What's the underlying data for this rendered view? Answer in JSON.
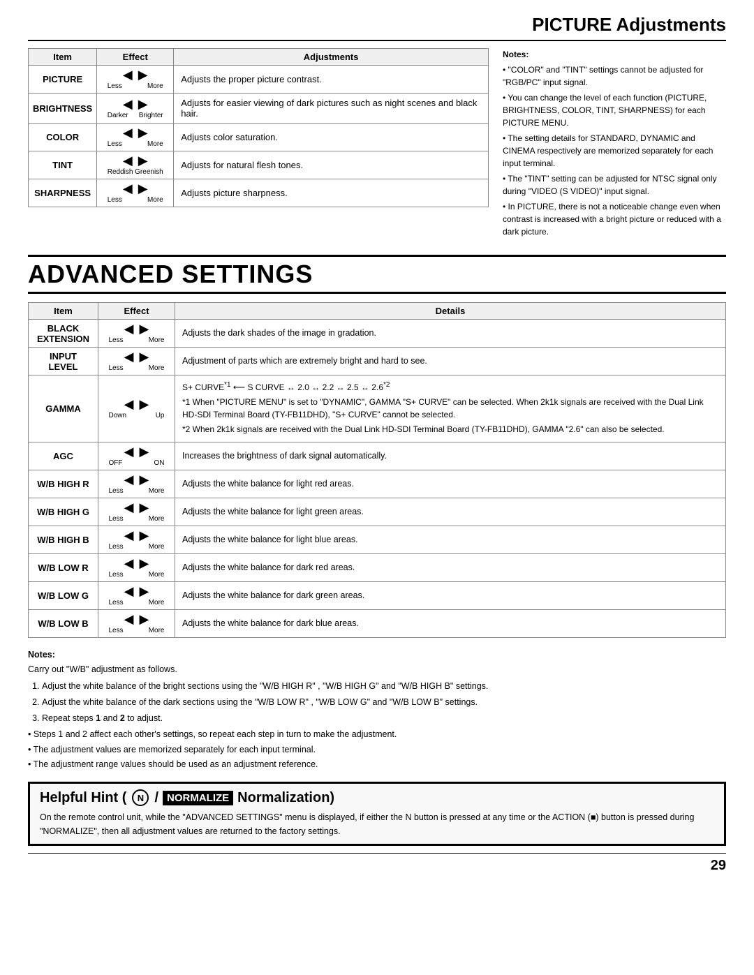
{
  "page": {
    "title": "PICTURE Adjustments",
    "advanced_title": "ADVANCED SETTINGS",
    "page_number": "29"
  },
  "picture_table": {
    "headers": [
      "Item",
      "Effect",
      "Adjustments"
    ],
    "rows": [
      {
        "item": "PICTURE",
        "arrow_left_label": "Less",
        "arrow_right_label": "More",
        "description": "Adjusts the proper picture contrast."
      },
      {
        "item": "BRIGHTNESS",
        "arrow_left_label": "Darker",
        "arrow_right_label": "Brighter",
        "description": "Adjusts for easier viewing of dark pictures such as night scenes and black hair."
      },
      {
        "item": "COLOR",
        "arrow_left_label": "Less",
        "arrow_right_label": "More",
        "description": "Adjusts color saturation."
      },
      {
        "item": "TINT",
        "arrow_left_label": "Reddish",
        "arrow_right_label": "Greenish",
        "description": "Adjusts for natural flesh tones."
      },
      {
        "item": "SHARPNESS",
        "arrow_left_label": "Less",
        "arrow_right_label": "More",
        "description": "Adjusts picture sharpness."
      }
    ]
  },
  "picture_notes": {
    "title": "Notes:",
    "items": [
      "\"COLOR\" and \"TINT\" settings cannot be adjusted for \"RGB/PC\" input signal.",
      "You can change the level of each function (PICTURE, BRIGHTNESS, COLOR, TINT, SHARPNESS) for each PICTURE MENU.",
      "The setting details for STANDARD, DYNAMIC and CINEMA respectively are memorized separately for each input terminal.",
      "The \"TINT\" setting can be adjusted for NTSC signal only during \"VIDEO (S VIDEO)\" input signal.",
      "In PICTURE, there is not a noticeable change even when contrast is increased with a bright picture or reduced with a dark picture."
    ]
  },
  "advanced_table": {
    "headers": [
      "Item",
      "Effect",
      "Details"
    ],
    "rows": [
      {
        "item": "BLACK\nEXTENSION",
        "arrow_left_label": "Less",
        "arrow_right_label": "More",
        "description": "Adjusts the dark shades of the image in gradation."
      },
      {
        "item": "INPUT\nLEVEL",
        "arrow_left_label": "Less",
        "arrow_right_label": "More",
        "description": "Adjustment of parts which are extremely bright and hard to see."
      },
      {
        "item": "GAMMA",
        "arrow_left_label": "Down",
        "arrow_right_label": "Up",
        "description": "S+ CURVE↔1 ⟵ S CURVE ←→ 2.0 ←→ 2.2 ←→ 2.5 ←→ 2.6*2\n*1 When \"PICTURE MENU\" is set to \"DYNAMIC\", GAMMA \"S+ CURVE\" can be selected. When 2k1k signals are received with the Dual Link HD-SDI Terminal Board (TY-FB11DHD), \"S+ CURVE\" cannot be selected.\n*2 When 2k1k signals are received with the Dual Link HD-SDI Terminal Board (TY-FB11DHD), GAMMA \"2.6\" can also be selected."
      },
      {
        "item": "AGC",
        "arrow_left_label": "OFF",
        "arrow_right_label": "ON",
        "description": "Increases the brightness of dark signal automatically."
      },
      {
        "item": "W/B HIGH R",
        "arrow_left_label": "Less",
        "arrow_right_label": "More",
        "description": "Adjusts the white balance for light red areas."
      },
      {
        "item": "W/B HIGH G",
        "arrow_left_label": "Less",
        "arrow_right_label": "More",
        "description": "Adjusts the white balance for light green areas."
      },
      {
        "item": "W/B HIGH B",
        "arrow_left_label": "Less",
        "arrow_right_label": "More",
        "description": "Adjusts the white balance for light blue areas."
      },
      {
        "item": "W/B LOW R",
        "arrow_left_label": "Less",
        "arrow_right_label": "More",
        "description": "Adjusts the white balance for dark red areas."
      },
      {
        "item": "W/B LOW G",
        "arrow_left_label": "Less",
        "arrow_right_label": "More",
        "description": "Adjusts the white balance for dark green areas."
      },
      {
        "item": "W/B LOW B",
        "arrow_left_label": "Less",
        "arrow_right_label": "More",
        "description": "Adjusts the white balance for dark blue areas."
      }
    ]
  },
  "advanced_notes": {
    "title": "Notes:",
    "intro": "Carry out \"W/B\" adjustment as follows.",
    "steps": [
      "Adjust the white balance of the bright sections using the \"W/B HIGH R\" , \"W/B HIGH G\" and \"W/B HIGH B\" settings.",
      "Adjust the white balance of the dark sections using the \"W/B LOW R\" , \"W/B LOW G\" and \"W/B LOW B\" settings.",
      "Repeat steps 1 and 2 to adjust."
    ],
    "extra": [
      "Steps 1 and 2 affect each other's settings, so repeat each step in turn to make the adjustment.",
      "The adjustment values are memorized separately for each input terminal.",
      "The adjustment range values should be used as an adjustment reference."
    ]
  },
  "helpful_hint": {
    "label": "Helpful Hint (",
    "n_label": "N",
    "slash": "/",
    "normalize_label": "NORMALIZE",
    "normalization_label": "Normalization)",
    "body": "On the remote control unit, while the \"ADVANCED SETTINGS\" menu is displayed, if either the N button is pressed at any time or the ACTION (■) button is pressed during \"NORMALIZE\", then all adjustment values are returned to the factory settings."
  }
}
